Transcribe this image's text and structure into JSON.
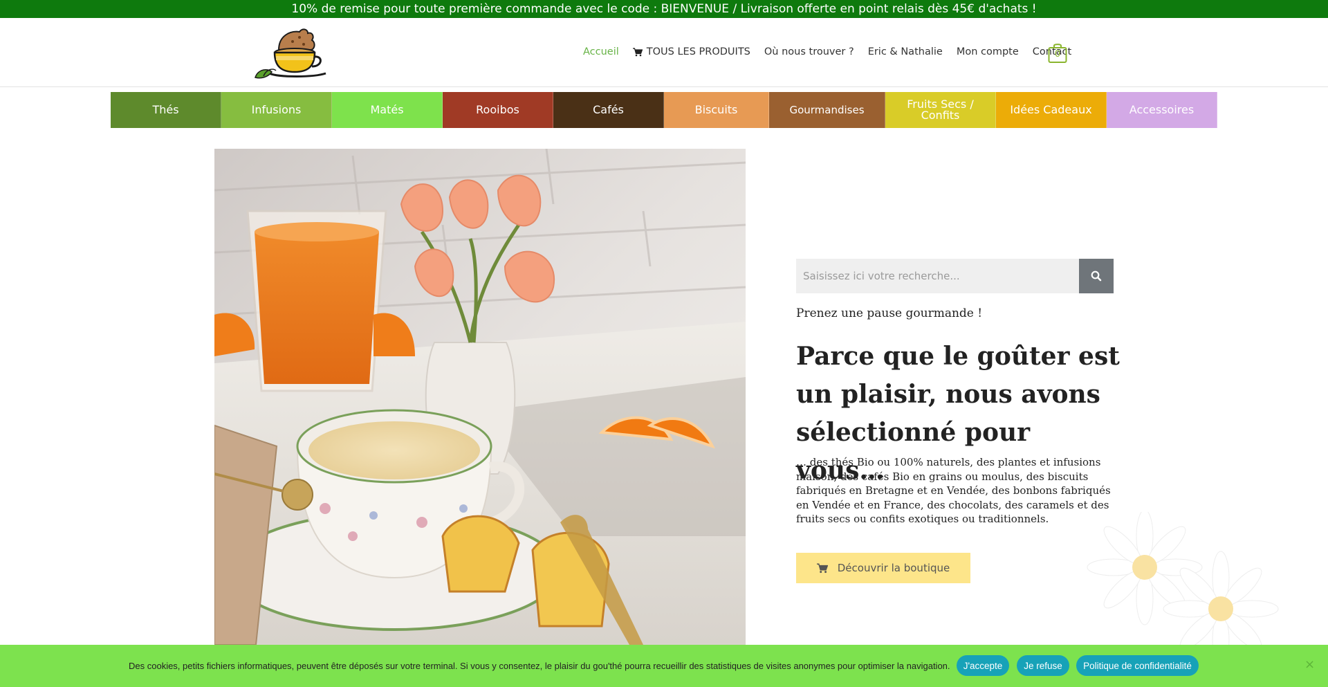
{
  "promo": {
    "text": "10% de remise pour toute première commande avec le code : BIENVENUE / Livraison offerte en point relais dès 45€ d'achats !",
    "background": "#0e7a0d"
  },
  "header": {
    "nav": [
      {
        "label": "Accueil",
        "active": true
      },
      {
        "label": "TOUS LES PRODUITS",
        "icon": "cart-icon"
      },
      {
        "label": "Où nous trouver ?"
      },
      {
        "label": "Eric & Nathalie"
      },
      {
        "label": "Mon compte"
      },
      {
        "label": "Contact"
      }
    ],
    "cart_count": "0",
    "accent": "#67b346"
  },
  "categories": [
    {
      "label": "Thés",
      "color": "#5e8a2c"
    },
    {
      "label": "Infusions",
      "color": "#86bd40"
    },
    {
      "label": "Matés",
      "color": "#7ee24c"
    },
    {
      "label": "Rooibos",
      "color": "#a03a25"
    },
    {
      "label": "Cafés",
      "color": "#4a3016"
    },
    {
      "label": "Biscuits",
      "color": "#e79a54"
    },
    {
      "label": "Gourmandises",
      "color": "#9a6030"
    },
    {
      "label": "Fruits Secs / Confits",
      "color": "#d9cc28"
    },
    {
      "label": "Idées Cadeaux",
      "color": "#ecac08"
    },
    {
      "label": "Accessoires",
      "color": "#d3a9e6"
    }
  ],
  "search": {
    "placeholder": "Saisissez ici votre recherche...",
    "icon": "search-icon"
  },
  "hero": {
    "tagline": "Prenez une pause gourmande !",
    "heading": "Parce que le goûter est un plaisir, nous avons sélectionné pour vous…",
    "description": "… des thés Bio ou 100% naturels, des plantes et infusions maison, des cafés Bio en grains ou moulus, des biscuits fabriqués en Bretagne et en Vendée,  des bonbons fabriqués en Vendée et en France, des chocolats, des caramels et des fruits secs ou confits exotiques ou traditionnels.",
    "button_label": "Découvrir la boutique",
    "button_color": "#fde58a"
  },
  "cookie": {
    "text": "Des cookies, petits fichiers informatiques, peuvent être déposés sur votre terminal. Si vous y consentez, le plaisir du gou'thé pourra recueillir des statistiques de visites anonymes pour optimiser la navigation.",
    "accept": "J'accepte",
    "refuse": "Je refuse",
    "policy": "Politique de confidentialité",
    "close": "×",
    "background": "#7de24e",
    "button_color": "#17a2b8"
  }
}
